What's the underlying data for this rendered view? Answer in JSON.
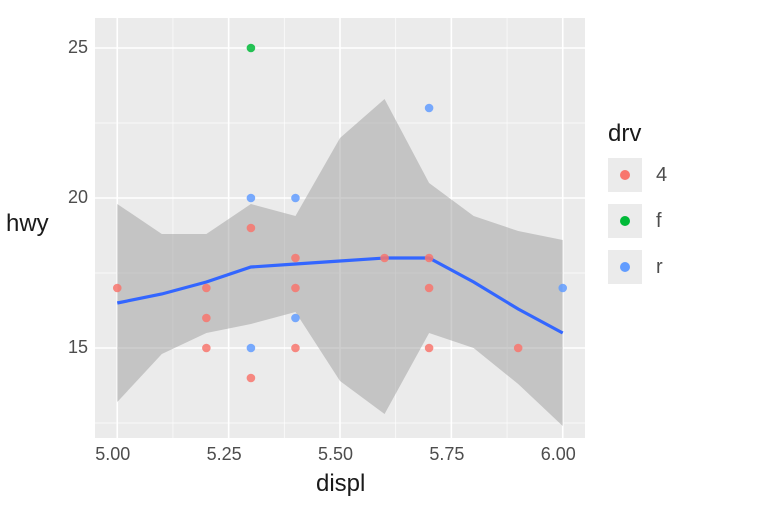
{
  "chart_data": {
    "type": "scatter",
    "title": "",
    "xlabel": "displ",
    "ylabel": "hwy",
    "xlim": [
      4.95,
      6.05
    ],
    "ylim": [
      12.0,
      26.0
    ],
    "x_ticks": [
      5.0,
      5.25,
      5.5,
      5.75,
      6.0
    ],
    "y_ticks": [
      15,
      20,
      25
    ],
    "x_tick_labels": [
      "5.00",
      "5.25",
      "5.50",
      "5.75",
      "6.00"
    ],
    "y_tick_labels": [
      "15",
      "20",
      "25"
    ],
    "legend_title": "drv",
    "legend_items": [
      "4",
      "f",
      "r"
    ],
    "colors": {
      "4": "#F8766D",
      "f": "#00BA38",
      "r": "#619CFF",
      "smooth": "#3366FF",
      "ribbon": "#999999"
    },
    "series": [
      {
        "name": "4",
        "points": [
          {
            "x": 5.0,
            "y": 17
          },
          {
            "x": 5.2,
            "y": 17
          },
          {
            "x": 5.2,
            "y": 16
          },
          {
            "x": 5.2,
            "y": 15
          },
          {
            "x": 5.3,
            "y": 19
          },
          {
            "x": 5.3,
            "y": 14
          },
          {
            "x": 5.4,
            "y": 18
          },
          {
            "x": 5.4,
            "y": 17
          },
          {
            "x": 5.4,
            "y": 15
          },
          {
            "x": 5.6,
            "y": 18
          },
          {
            "x": 5.7,
            "y": 18
          },
          {
            "x": 5.7,
            "y": 17
          },
          {
            "x": 5.7,
            "y": 15
          },
          {
            "x": 5.9,
            "y": 15
          }
        ]
      },
      {
        "name": "f",
        "points": [
          {
            "x": 5.3,
            "y": 25
          }
        ]
      },
      {
        "name": "r",
        "points": [
          {
            "x": 5.3,
            "y": 20
          },
          {
            "x": 5.3,
            "y": 15
          },
          {
            "x": 5.4,
            "y": 20
          },
          {
            "x": 5.4,
            "y": 16
          },
          {
            "x": 5.7,
            "y": 23
          },
          {
            "x": 6.0,
            "y": 17
          }
        ]
      }
    ],
    "smooth": {
      "x": [
        5.0,
        5.1,
        5.2,
        5.3,
        5.4,
        5.5,
        5.6,
        5.7,
        5.8,
        5.9,
        6.0
      ],
      "y": [
        16.5,
        16.8,
        17.2,
        17.7,
        17.8,
        17.9,
        18.0,
        18.0,
        17.2,
        16.3,
        15.5
      ],
      "lo": [
        13.2,
        14.8,
        15.5,
        15.8,
        16.2,
        13.9,
        12.8,
        15.5,
        15.0,
        13.8,
        12.4
      ],
      "hi": [
        19.8,
        18.8,
        18.8,
        19.8,
        19.4,
        22.0,
        23.3,
        20.5,
        19.4,
        18.9,
        18.6
      ]
    }
  }
}
